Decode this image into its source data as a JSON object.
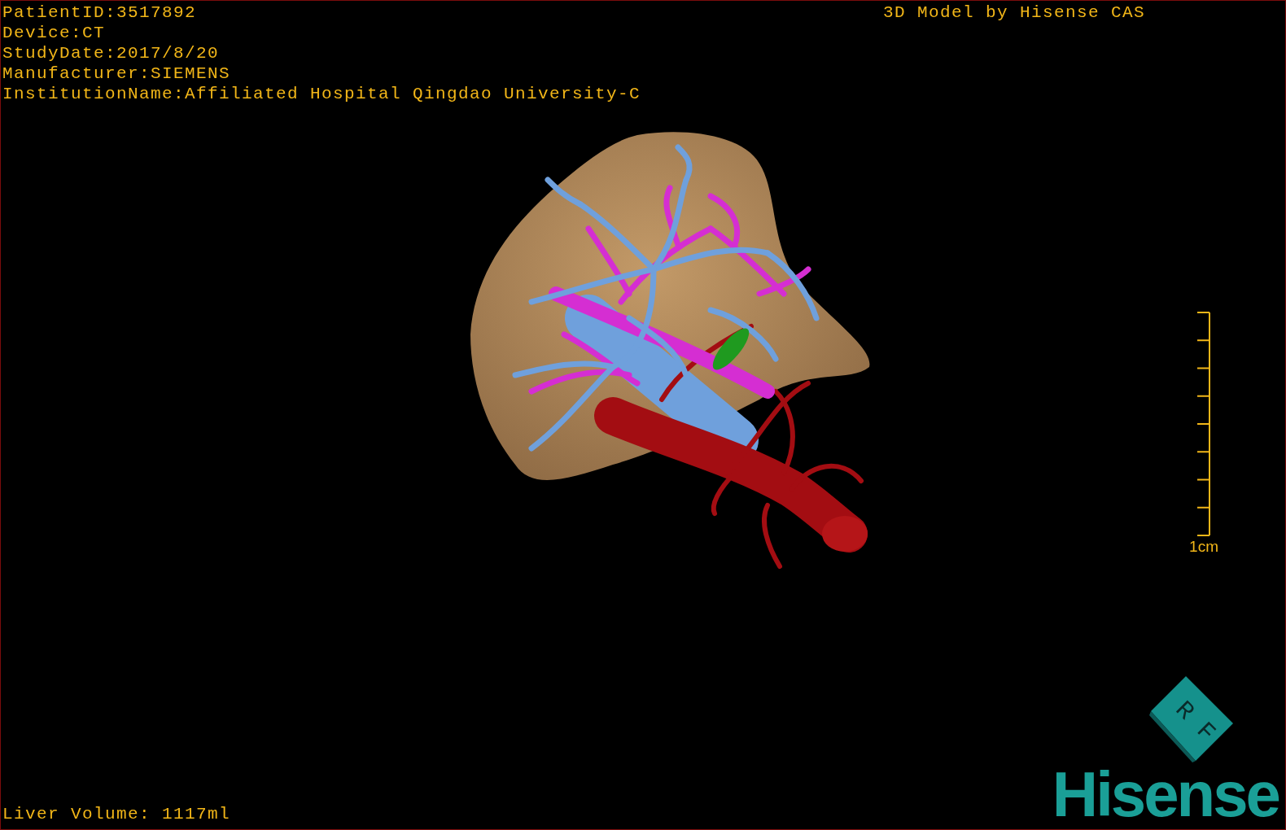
{
  "patient_info": [
    "PatientID:3517892",
    "Device:CT",
    "StudyDate:2017/8/20",
    "Manufacturer:SIEMENS",
    "InstitutionName:Affiliated Hospital Qingdao University-C"
  ],
  "title": "3D Model by Hisense CAS",
  "scale_bar": {
    "label": "1cm"
  },
  "liver_volume": "Liver Volume: 1117ml",
  "orientation_cube": {
    "letters": [
      "R",
      "F"
    ]
  },
  "logo": {
    "text": "Hisense"
  }
}
